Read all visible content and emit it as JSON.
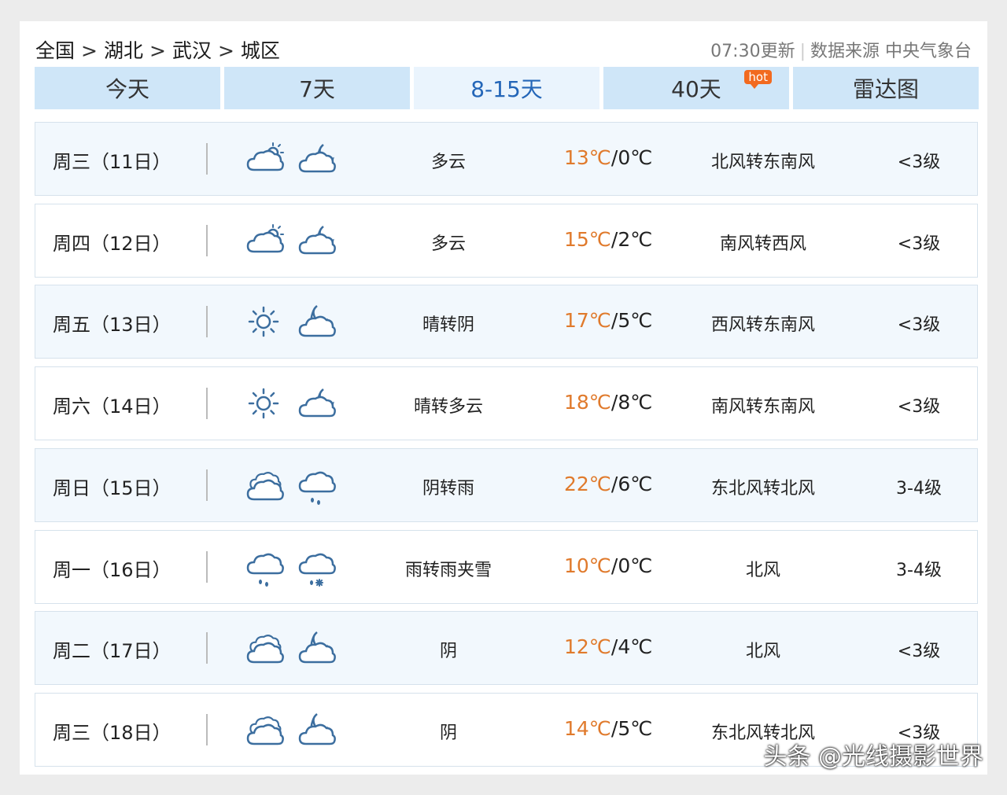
{
  "breadcrumb": [
    "全国",
    "湖北",
    "武汉",
    "城区"
  ],
  "breadcrumb_separator": ">",
  "update_time": "07:30更新",
  "data_source": "数据来源 中央气象台",
  "tabs": [
    {
      "label": "今天"
    },
    {
      "label": "7天"
    },
    {
      "label": "8-15天",
      "active": true
    },
    {
      "label": "40天",
      "badge": "hot"
    },
    {
      "label": "雷达图"
    }
  ],
  "forecast": [
    {
      "day": "周三（11日）",
      "icons": [
        "partly-cloudy-day-icon",
        "cloudy-night-icon"
      ],
      "desc": "多云",
      "high": "13℃",
      "low": "0℃",
      "wind": "北风转东南风",
      "level": "<3级"
    },
    {
      "day": "周四（12日）",
      "icons": [
        "partly-cloudy-day-icon",
        "cloudy-night-icon"
      ],
      "desc": "多云",
      "high": "15℃",
      "low": "2℃",
      "wind": "南风转西风",
      "level": "<3级"
    },
    {
      "day": "周五（13日）",
      "icons": [
        "sunny-icon",
        "overcast-night-icon"
      ],
      "desc": "晴转阴",
      "high": "17℃",
      "low": "5℃",
      "wind": "西风转东南风",
      "level": "<3级"
    },
    {
      "day": "周六（14日）",
      "icons": [
        "sunny-icon",
        "cloudy-night-icon"
      ],
      "desc": "晴转多云",
      "high": "18℃",
      "low": "8℃",
      "wind": "南风转东南风",
      "level": "<3级"
    },
    {
      "day": "周日（15日）",
      "icons": [
        "overcast-icon",
        "rain-icon"
      ],
      "desc": "阴转雨",
      "high": "22℃",
      "low": "6℃",
      "wind": "东北风转北风",
      "level": "3-4级"
    },
    {
      "day": "周一（16日）",
      "icons": [
        "rain-icon",
        "sleet-icon"
      ],
      "desc": "雨转雨夹雪",
      "high": "10℃",
      "low": "0℃",
      "wind": "北风",
      "level": "3-4级"
    },
    {
      "day": "周二（17日）",
      "icons": [
        "overcast-icon",
        "overcast-night-icon"
      ],
      "desc": "阴",
      "high": "12℃",
      "low": "4℃",
      "wind": "北风",
      "level": "<3级"
    },
    {
      "day": "周三（18日）",
      "icons": [
        "overcast-icon",
        "overcast-night-icon"
      ],
      "desc": "阴",
      "high": "14℃",
      "low": "5℃",
      "wind": "东北风转北风",
      "level": "<3级"
    }
  ],
  "watermark": "头条 @光线摄影世界",
  "colors": {
    "tab_bg": "#cfe6f8",
    "tab_active_text": "#2466b8",
    "high_temp": "#e07a2c",
    "icon_stroke": "#3c6e9f",
    "hot_badge": "#f26a1f"
  }
}
